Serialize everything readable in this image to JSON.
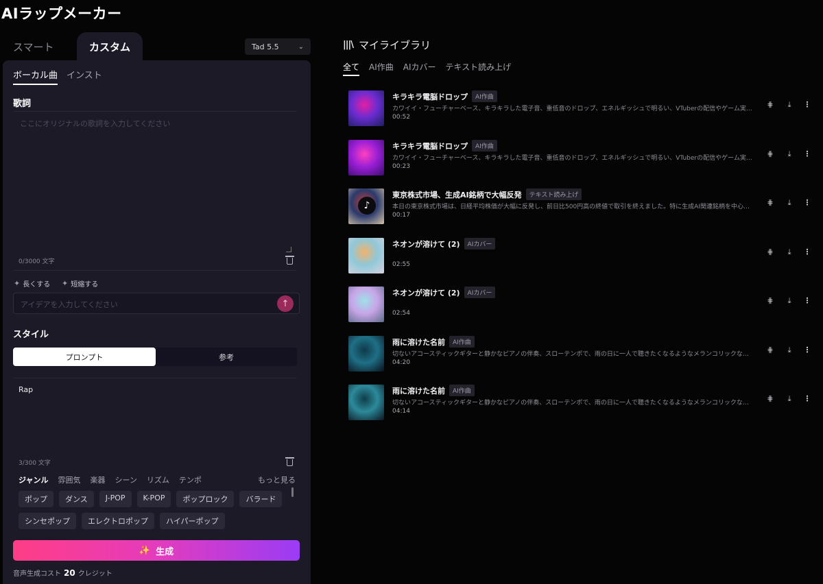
{
  "app": {
    "title": "AIラップメーカー"
  },
  "mode_tabs": {
    "smart": "スマート",
    "custom": "カスタム"
  },
  "model": {
    "selected": "Tad 5.5",
    "chevron_icon": "chevron-down-icon"
  },
  "sub_tabs": {
    "vocal": "ボーカル曲",
    "instrumental": "インスト"
  },
  "lyrics": {
    "title": "歌詞",
    "placeholder": "ここにオリジナルの歌詞を入力してください",
    "counter": "0/3000 文字",
    "extend_label": "長くする",
    "shorten_label": "短縮する",
    "idea_placeholder": "アイデアを入力してください"
  },
  "style": {
    "title": "スタイル",
    "tab_prompt": "プロンプト",
    "tab_reference": "参考",
    "value": "Rap",
    "counter": "3/300 文字",
    "categories": [
      "ジャンル",
      "雰囲気",
      "楽器",
      "シーン",
      "リズム",
      "テンポ"
    ],
    "more": "もっと見る",
    "chips": [
      "ポップ",
      "ダンス",
      "J-POP",
      "K-POP",
      "ポップロック",
      "バラード",
      "シンセポップ",
      "エレクトロポップ",
      "ハイパーポップ"
    ]
  },
  "generate": {
    "label": "生成",
    "icon": "sparkle-icon"
  },
  "cost": {
    "prefix": "音声生成コスト",
    "amount": "20",
    "suffix": "クレジット"
  },
  "library": {
    "title": "マイライブラリ",
    "tabs": [
      "全て",
      "AI作曲",
      "AIカバー",
      "テキスト読み上げ"
    ],
    "tracks": [
      {
        "title": "キラキラ電脳ドロップ",
        "badge": "AI作曲",
        "desc": "カワイイ・フューチャーベース、キラキラした電子音、重低音のドロップ、エネルギッシュで明るい、VTuberの配信やゲーム実況に使えそうなポップなトラック",
        "duration": "00:52",
        "thumb_colors": [
          "#e51fa3",
          "#6a2cd1",
          "#1a1f5c"
        ]
      },
      {
        "title": "キラキラ電脳ドロップ",
        "badge": "AI作曲",
        "desc": "カワイイ・フューチャーベース、キラキラした電子音、重低音のドロップ、エネルギッシュで明るい、VTuberの配信やゲーム実況に使えそうなポップなトラック",
        "duration": "00:23",
        "thumb_colors": [
          "#ff3fbf",
          "#9a1fd6",
          "#3a0d6e"
        ]
      },
      {
        "title": "東京株式市場、生成AI銘柄で大幅反発",
        "badge": "テキスト読み上げ",
        "desc": "本日の東京株式市場は、日経平均株価が大幅に反発し、前日比500円高の終値で取引を終えました。特に生成AI関連銘柄を中心に、買いが広がりました。",
        "duration": "00:17",
        "thumb_colors": [
          "#c23b3b",
          "#2a3a6b",
          "#d8c4a8"
        ],
        "music_icon": "music-note-icon"
      },
      {
        "title": "ネオンが溶けて (2)",
        "badge": "AIカバー",
        "desc": "",
        "duration": "02:55",
        "thumb_colors": [
          "#f4b26a",
          "#8fc8d8",
          "#d7d2e0"
        ]
      },
      {
        "title": "ネオンが溶けて (2)",
        "badge": "AIカバー",
        "desc": "",
        "duration": "02:54",
        "thumb_colors": [
          "#9fe0e8",
          "#c8a5e8",
          "#5c6c8a"
        ]
      },
      {
        "title": "雨に溶けた名前",
        "badge": "AI作曲",
        "desc": "切ないアコースティックギターと静かなピアノの伴奏、スローテンポで、雨の日に一人で聴きたくなるようなメランコリックな雰囲気のバラード",
        "duration": "04:20",
        "thumb_colors": [
          "#0e3a4a",
          "#1f6f86",
          "#0a0f1a"
        ]
      },
      {
        "title": "雨に溶けた名前",
        "badge": "AI作曲",
        "desc": "切ないアコースティックギターと静かなピアノの伴奏、スローテンポで、雨の日に一人で聴きたくなるようなメランコリックな雰囲気のバラード",
        "duration": "04:14",
        "thumb_colors": [
          "#103c48",
          "#2c8a9a",
          "#0b1420"
        ]
      }
    ]
  }
}
